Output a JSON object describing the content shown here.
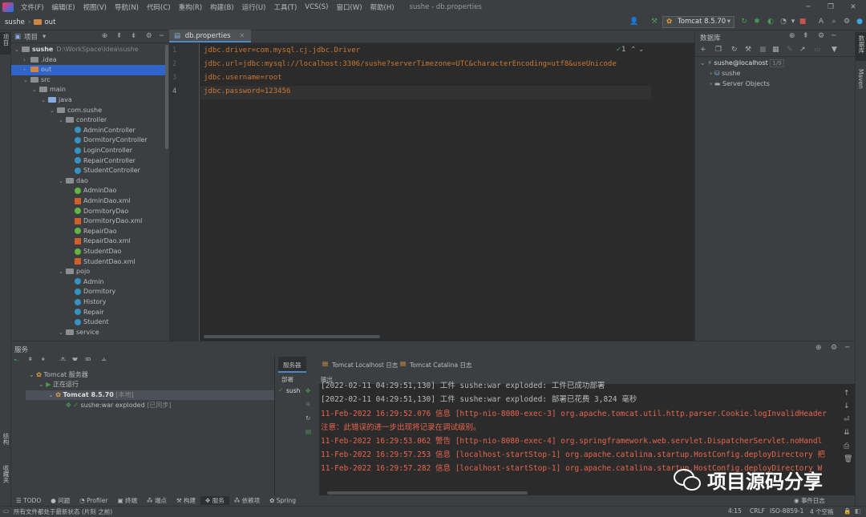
{
  "menubar": {
    "items": [
      "文件(F)",
      "编辑(E)",
      "视图(V)",
      "导航(N)",
      "代码(C)",
      "重构(R)",
      "构建(B)",
      "运行(U)",
      "工具(T)",
      "VCS(S)",
      "窗口(W)",
      "帮助(H)"
    ],
    "title": "sushe - db.properties"
  },
  "navbar": {
    "project": "sushe",
    "folder": "out",
    "run_config": "Tomcat 8.5.70"
  },
  "leftstrip": {
    "project_label": "项目",
    "structure_label": "结构",
    "favorites_label": "收藏夹"
  },
  "rightstrip": {
    "database_label": "数据库",
    "maven_label": "Maven"
  },
  "project_panel": {
    "title": "项目",
    "tree": [
      {
        "label": "sushe",
        "extra": "D:\\WorkSpace\\Idea\\sushe",
        "icon": "folder-gray",
        "depth": 0,
        "open": true
      },
      {
        "label": ".idea",
        "icon": "folder-gray",
        "depth": 1,
        "open": false
      },
      {
        "label": "out",
        "icon": "folder-orange",
        "depth": 1,
        "open": false,
        "selected": true
      },
      {
        "label": "src",
        "icon": "folder-gray",
        "depth": 1,
        "open": true
      },
      {
        "label": "main",
        "icon": "folder-gray",
        "depth": 2,
        "open": true
      },
      {
        "label": "java",
        "icon": "folder-blue",
        "depth": 3,
        "open": true
      },
      {
        "label": "com.sushe",
        "icon": "folder-gray",
        "depth": 4,
        "open": true
      },
      {
        "label": "controller",
        "icon": "folder-gray",
        "depth": 5,
        "open": true
      },
      {
        "label": "AdminController",
        "icon": "class",
        "depth": 6
      },
      {
        "label": "DormitoryController",
        "icon": "class",
        "depth": 6
      },
      {
        "label": "LoginController",
        "icon": "class",
        "depth": 6
      },
      {
        "label": "RepairController",
        "icon": "class",
        "depth": 6
      },
      {
        "label": "StudentController",
        "icon": "class",
        "depth": 6
      },
      {
        "label": "dao",
        "icon": "folder-gray",
        "depth": 5,
        "open": true
      },
      {
        "label": "AdminDao",
        "icon": "interface",
        "depth": 6
      },
      {
        "label": "AdminDao.xml",
        "icon": "xml",
        "depth": 6
      },
      {
        "label": "DormitoryDao",
        "icon": "interface",
        "depth": 6
      },
      {
        "label": "DormitoryDao.xml",
        "icon": "xml",
        "depth": 6
      },
      {
        "label": "RepairDao",
        "icon": "interface",
        "depth": 6
      },
      {
        "label": "RepairDao.xml",
        "icon": "xml",
        "depth": 6
      },
      {
        "label": "StudentDao",
        "icon": "interface",
        "depth": 6
      },
      {
        "label": "StudentDao.xml",
        "icon": "xml",
        "depth": 6
      },
      {
        "label": "pojo",
        "icon": "folder-gray",
        "depth": 5,
        "open": true
      },
      {
        "label": "Admin",
        "icon": "class",
        "depth": 6
      },
      {
        "label": "Dormitory",
        "icon": "class",
        "depth": 6
      },
      {
        "label": "History",
        "icon": "class",
        "depth": 6
      },
      {
        "label": "Repair",
        "icon": "class",
        "depth": 6
      },
      {
        "label": "Student",
        "icon": "class",
        "depth": 6
      },
      {
        "label": "service",
        "icon": "folder-gray",
        "depth": 5,
        "open": true
      }
    ]
  },
  "editor": {
    "tab": "db.properties",
    "inspection": "1",
    "lines": [
      {
        "num": "1",
        "text": "jdbc.driver=com.mysql.cj.jdbc.Driver"
      },
      {
        "num": "2",
        "text": "jdbc.url=jdbc:mysql://localhost:3306/sushe?serverTimezone=UTC&characterEncoding=utf8&useUnicode"
      },
      {
        "num": "3",
        "text": "jdbc.username=root"
      },
      {
        "num": "4",
        "text": "jdbc.password=123456"
      }
    ]
  },
  "database_panel": {
    "title": "数据库",
    "connection": "sushe@localhost",
    "connection_badge": "1/9",
    "items": [
      "sushe",
      "Server Objects"
    ]
  },
  "services": {
    "title": "服务",
    "tree": [
      {
        "label": "Tomcat 服务器"
      },
      {
        "label": "正在运行"
      },
      {
        "label": "Tomcat 8.5.70",
        "suffix": "[本地]"
      },
      {
        "label": "sushe:war exploded",
        "suffix": "[已同步]"
      }
    ],
    "tabs": [
      "服务器",
      "Tomcat Localhost 日志",
      "Tomcat Catalina 日志"
    ],
    "subtabs": {
      "deploy": "部署",
      "output": "输出"
    },
    "deploy_item": "sush",
    "console": [
      {
        "text": "[2022-02-11 04:29:51,130] 工件 sushe:war exploded: 工件已成功部署",
        "color": "#bbbbbb"
      },
      {
        "text": "[2022-02-11 04:29:51,130] 工件 sushe:war exploded: 部署已花费 3,824 毫秒",
        "color": "#bbbbbb"
      },
      {
        "text": "11-Feb-2022 16:29:52.076 信息 [http-nio-8080-exec-3] org.apache.tomcat.util.http.parser.Cookie.logInvalidHeader",
        "color": "#e8664e"
      },
      {
        "text": " 注意：此错误的进一步出现将记录在调试级别。",
        "color": "#e8664e"
      },
      {
        "text": "11-Feb-2022 16:29:53.062 警告 [http-nio-8080-exec-4] org.springframework.web.servlet.DispatcherServlet.noHandl",
        "color": "#e8664e"
      },
      {
        "text": "11-Feb-2022 16:29:57.253 信息 [localhost-startStop-1] org.apache.catalina.startup.HostConfig.deployDirectory 把",
        "color": "#e8664e"
      },
      {
        "text": "11-Feb-2022 16:29:57.282 信息 [localhost-startStop-1] org.apache.catalina.startup.HostConfig.deployDirectory W",
        "color": "#e8664e"
      }
    ]
  },
  "tool_tabs": [
    "TODO",
    "问题",
    "Profiler",
    "终端",
    "端点",
    "构建",
    "服务",
    "依赖项",
    "Spring"
  ],
  "status": {
    "message": "所有文件都处于最新状态 (片刻 之前)",
    "event_log": "事件日志",
    "position": "4:15",
    "line_sep": "CRLF",
    "encoding": "ISO-8859-1",
    "indent": "4 个空格"
  },
  "watermark": "项目源码分享"
}
